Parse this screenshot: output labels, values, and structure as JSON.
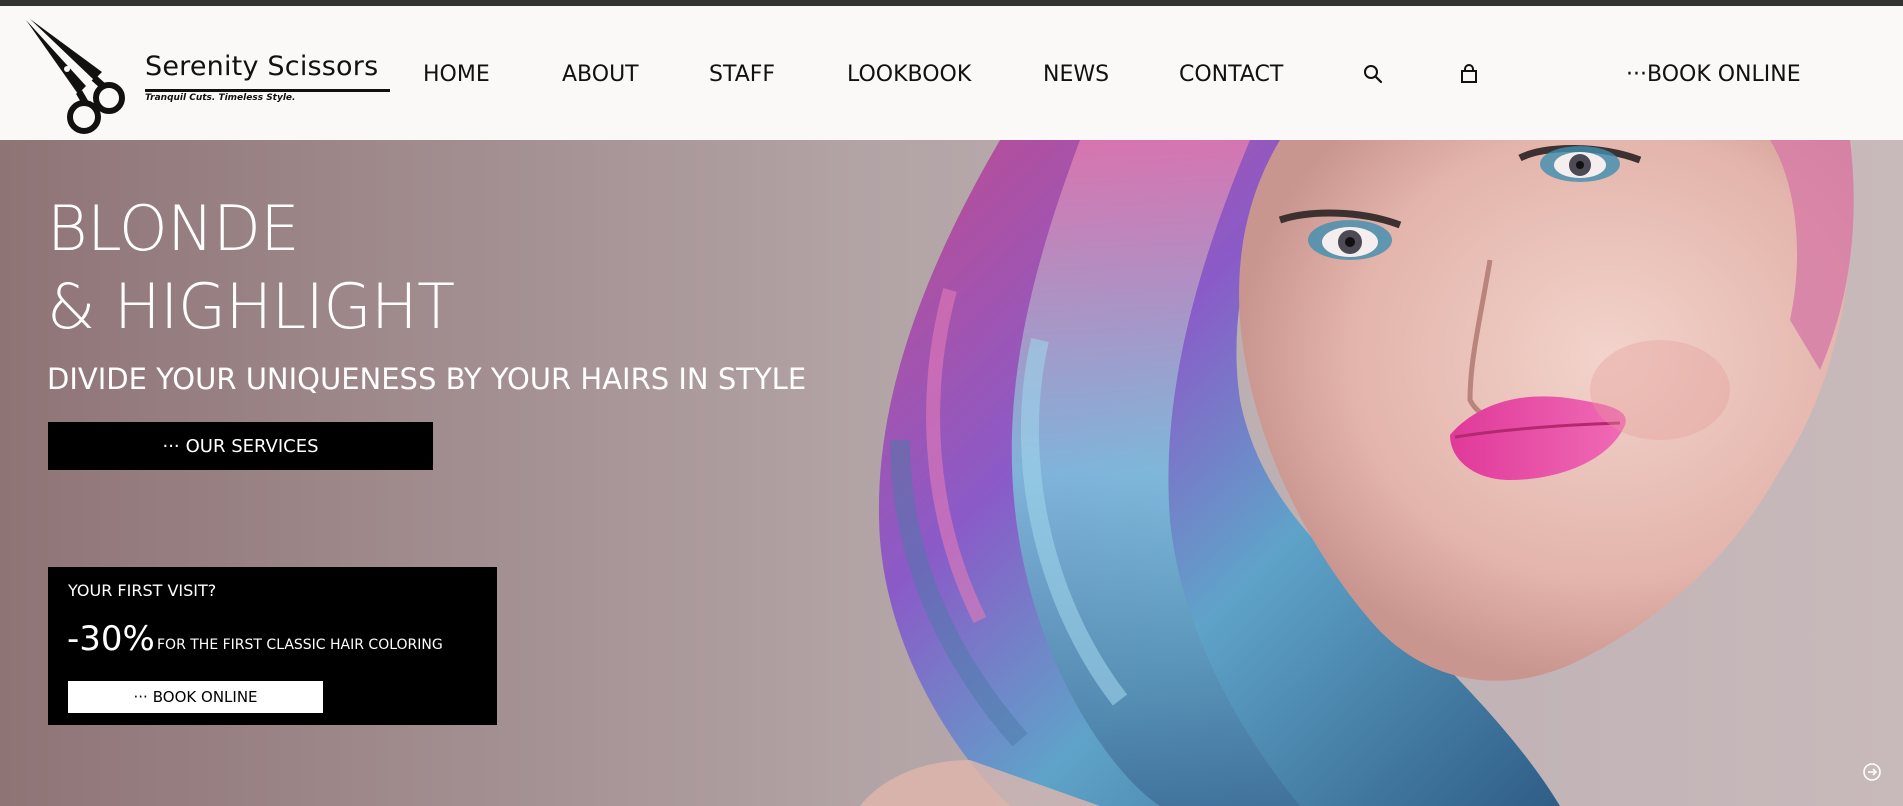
{
  "brand": {
    "name": "Serenity Scissors",
    "tagline": "Tranquil Cuts. Timeless Style."
  },
  "nav": {
    "items": [
      {
        "label": "HOME"
      },
      {
        "label": "ABOUT"
      },
      {
        "label": "STAFF"
      },
      {
        "label": "LOOKBOOK"
      },
      {
        "label": "NEWS"
      },
      {
        "label": "CONTACT"
      }
    ],
    "search_icon": "search-icon",
    "cart_icon": "shopping-bag-icon",
    "cta_label": "BOOK ONLINE"
  },
  "hero": {
    "title_line1": "BLONDE",
    "title_line2": "& HIGHLIGHT",
    "subtitle": "DIVIDE YOUR UNIQUENESS BY YOUR HAIRS IN STYLE",
    "button_label": "OUR SERVICES"
  },
  "promo": {
    "label": "YOUR FIRST VISIT?",
    "discount": "-30%",
    "description": "FOR THE FIRST CLASSIC HAIR COLORING",
    "button_label": "BOOK ONLINE"
  },
  "colors": {
    "accent": "#000000",
    "header_bg": "#faf9f7",
    "hero_bg": "#b2a3a5",
    "text_light": "#ffffff"
  }
}
